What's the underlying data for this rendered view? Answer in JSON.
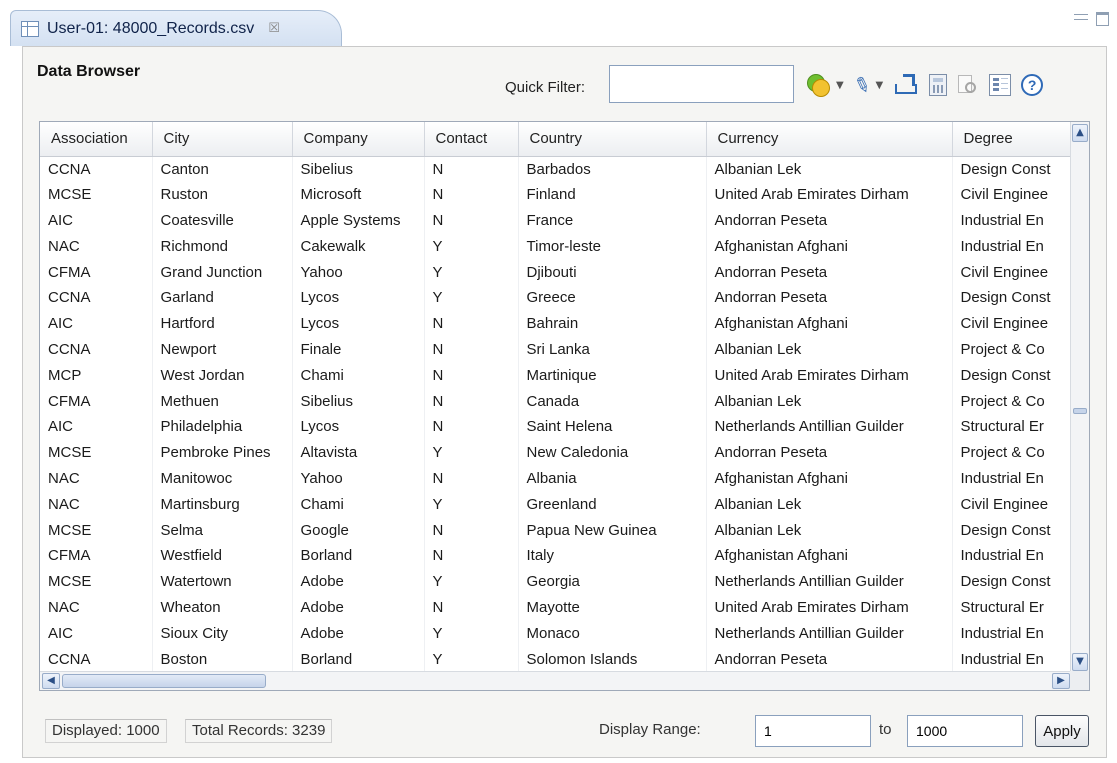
{
  "tab": {
    "title": "User-01: 48000_Records.csv",
    "close_glyph": "☒"
  },
  "panel": {
    "title": "Data Browser"
  },
  "quick_filter": {
    "label": "Quick Filter:",
    "value": "",
    "placeholder": ""
  },
  "toolbar": {
    "icons": [
      "filter-icon",
      "edit-icon",
      "export-icon",
      "calculator-icon",
      "find-icon",
      "columns-icon",
      "help-icon"
    ],
    "help_glyph": "?"
  },
  "table": {
    "columns": [
      "Association",
      "City",
      "Company",
      "Contact",
      "Country",
      "Currency",
      "Degree"
    ],
    "rows": [
      [
        "CCNA",
        "Canton",
        "Sibelius",
        "N",
        "Barbados",
        "Albanian Lek",
        "Design Const"
      ],
      [
        "MCSE",
        "Ruston",
        "Microsoft",
        "N",
        "Finland",
        "United Arab Emirates Dirham",
        "Civil Enginee"
      ],
      [
        "AIC",
        "Coatesville",
        "Apple Systems",
        "N",
        "France",
        "Andorran Peseta",
        "Industrial En"
      ],
      [
        "NAC",
        "Richmond",
        "Cakewalk",
        "Y",
        "Timor-leste",
        "Afghanistan Afghani",
        "Industrial En"
      ],
      [
        "CFMA",
        "Grand Junction",
        "Yahoo",
        "Y",
        "Djibouti",
        "Andorran Peseta",
        "Civil Enginee"
      ],
      [
        "CCNA",
        "Garland",
        "Lycos",
        "Y",
        "Greece",
        "Andorran Peseta",
        "Design Const"
      ],
      [
        "AIC",
        "Hartford",
        "Lycos",
        "N",
        "Bahrain",
        "Afghanistan Afghani",
        "Civil Enginee"
      ],
      [
        "CCNA",
        "Newport",
        "Finale",
        "N",
        "Sri Lanka",
        "Albanian Lek",
        "Project & Co"
      ],
      [
        "MCP",
        "West Jordan",
        "Chami",
        "N",
        "Martinique",
        "United Arab Emirates Dirham",
        "Design Const"
      ],
      [
        "CFMA",
        "Methuen",
        "Sibelius",
        "N",
        "Canada",
        "Albanian Lek",
        "Project & Co"
      ],
      [
        "AIC",
        "Philadelphia",
        "Lycos",
        "N",
        "Saint Helena",
        "Netherlands Antillian Guilder",
        "Structural Er"
      ],
      [
        "MCSE",
        "Pembroke Pines",
        "Altavista",
        "Y",
        "New Caledonia",
        "Andorran Peseta",
        "Project & Co"
      ],
      [
        "NAC",
        "Manitowoc",
        "Yahoo",
        "N",
        "Albania",
        "Afghanistan Afghani",
        "Industrial En"
      ],
      [
        "NAC",
        "Martinsburg",
        "Chami",
        "Y",
        "Greenland",
        "Albanian Lek",
        "Civil Enginee"
      ],
      [
        "MCSE",
        "Selma",
        "Google",
        "N",
        "Papua New Guinea",
        "Albanian Lek",
        "Design Const"
      ],
      [
        "CFMA",
        "Westfield",
        "Borland",
        "N",
        "Italy",
        "Afghanistan Afghani",
        "Industrial En"
      ],
      [
        "MCSE",
        "Watertown",
        "Adobe",
        "Y",
        "Georgia",
        "Netherlands Antillian Guilder",
        "Design Const"
      ],
      [
        "NAC",
        "Wheaton",
        "Adobe",
        "N",
        "Mayotte",
        "United Arab Emirates Dirham",
        "Structural Er"
      ],
      [
        "AIC",
        "Sioux City",
        "Adobe",
        "Y",
        "Monaco",
        "Netherlands Antillian Guilder",
        "Industrial En"
      ],
      [
        "CCNA",
        "Boston",
        "Borland",
        "Y",
        "Solomon Islands",
        "Andorran Peseta",
        "Industrial En"
      ]
    ]
  },
  "status": {
    "displayed": "Displayed: 1000",
    "total": "Total Records: 3239"
  },
  "range": {
    "label": "Display Range:",
    "from": "1",
    "to_label": "to",
    "to": "1000",
    "apply_label": "Apply"
  },
  "colors": {
    "accent": "#2e6ab5",
    "tab_bg": "#d4e1f2",
    "panel_bg": "#f5f5f3"
  }
}
